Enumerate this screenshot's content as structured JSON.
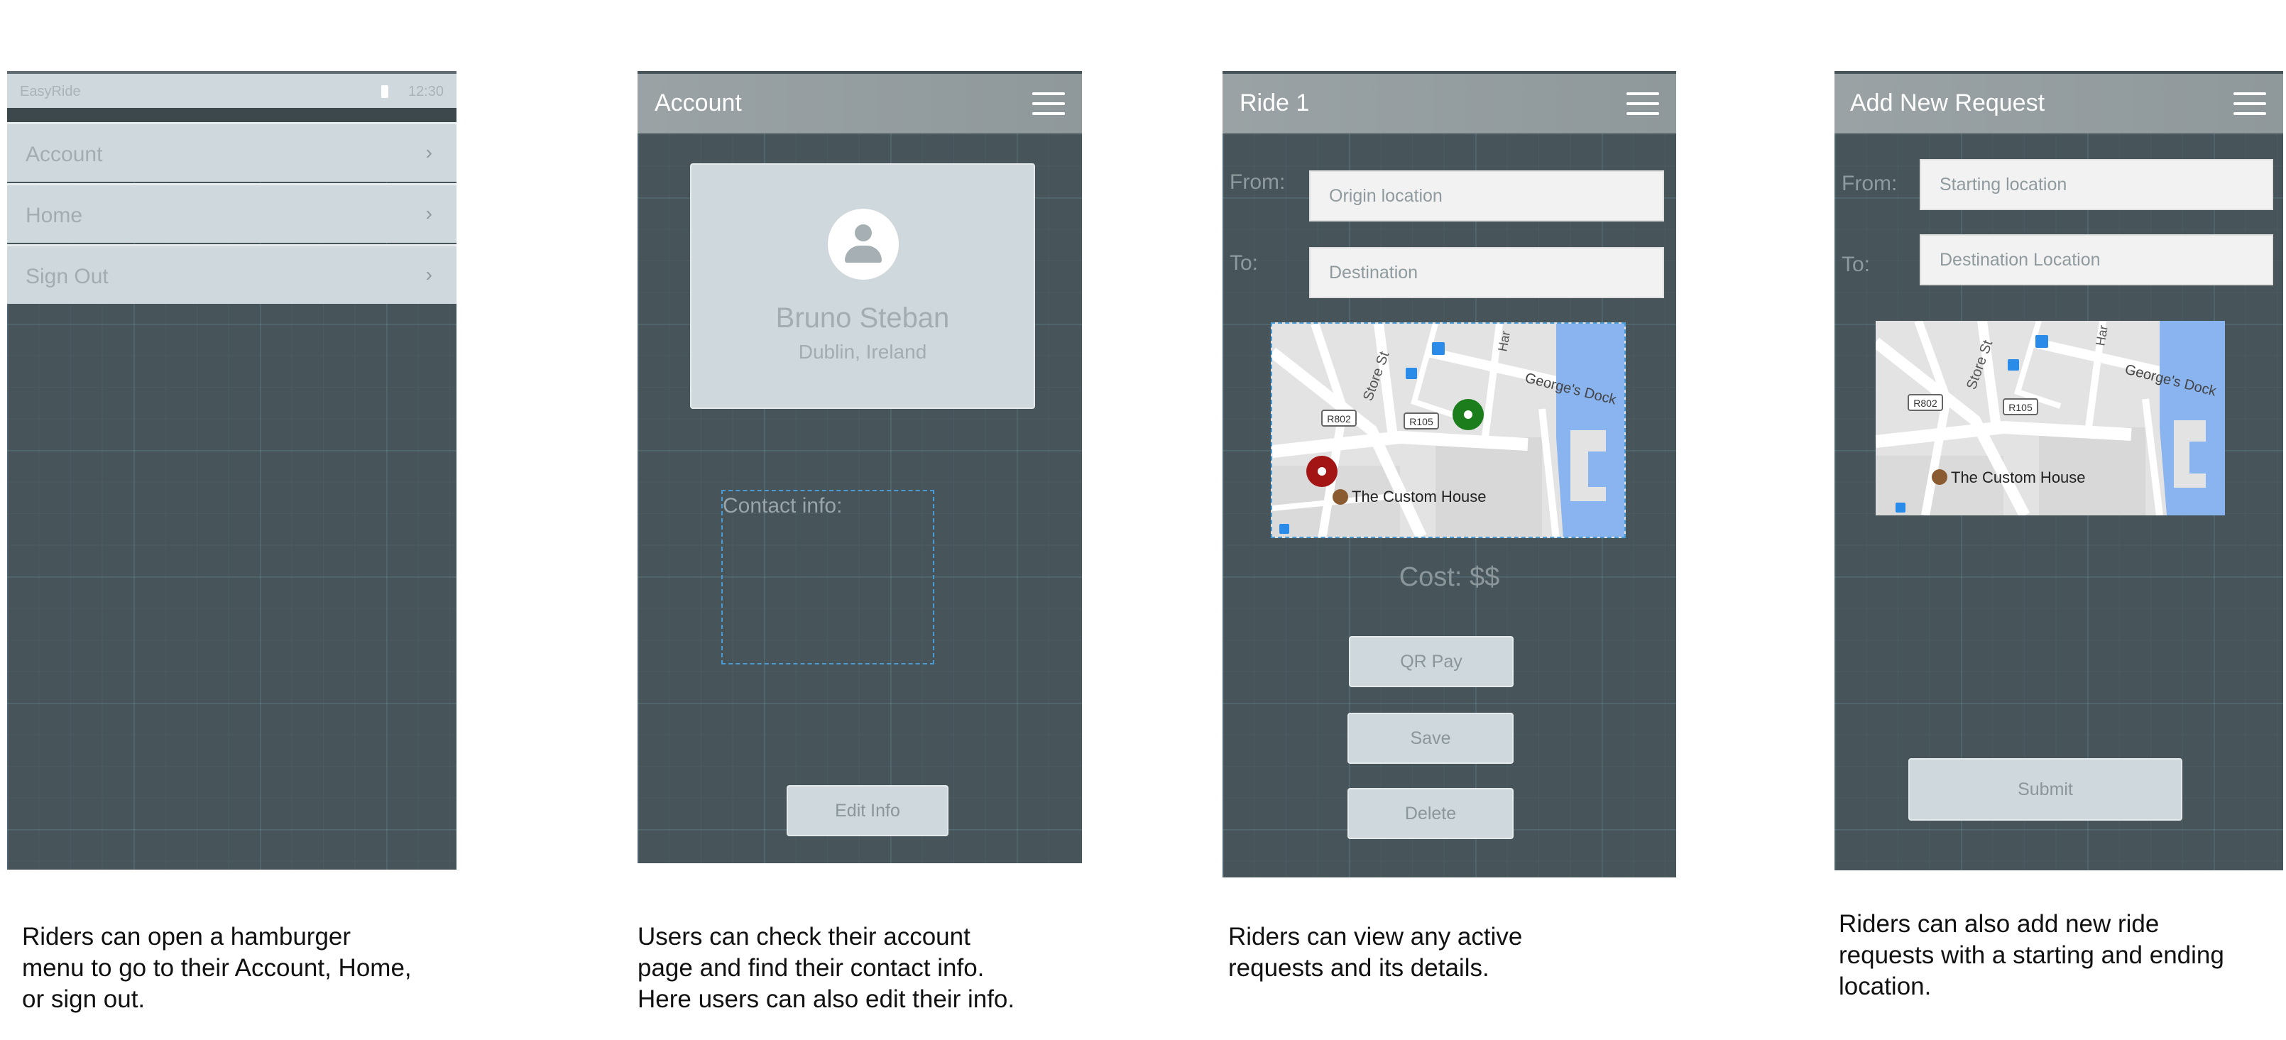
{
  "screen_menu": {
    "status_app_name": "EasyRide",
    "status_time": "12:30",
    "menu_items": [
      {
        "label": "Account",
        "chevron": "›"
      },
      {
        "label": "Home",
        "chevron": "›"
      },
      {
        "label": "Sign Out",
        "chevron": "›"
      }
    ],
    "caption": "Riders can open a hamburger\nmenu to go to their Account, Home,\nor sign out."
  },
  "screen_account": {
    "title": "Account",
    "profile_name": "Bruno Steban",
    "profile_location": "Dublin, Ireland",
    "contact_label": "Contact info:",
    "edit_button": "Edit Info",
    "caption": "Users can check their account\npage and find their contact info.\nHere users can also edit their info."
  },
  "screen_ride": {
    "title": "Ride 1",
    "from_label": "From:",
    "from_value": "Origin location",
    "to_label": "To:",
    "to_value": "Destination",
    "map_labels": {
      "street_store": "Store St",
      "dock": "George's Dock",
      "road_r802": "R802",
      "road_r105": "R105",
      "custom_house": "The Custom House",
      "hall": "Har"
    },
    "cost": "Cost: $$",
    "buttons": [
      "QR Pay",
      "Save",
      "Delete"
    ],
    "caption": "Riders can view any active\nrequests and its details."
  },
  "screen_request": {
    "title": "Add New Request",
    "from_label": "From:",
    "from_placeholder": "Starting location",
    "to_label": "To:",
    "to_placeholder": "Destination Location",
    "map_labels": {
      "street_store": "Store St",
      "dock": "George's Dock",
      "road_r802": "R802",
      "road_r105": "R105",
      "custom_house": "The Custom House",
      "hall": "Har"
    },
    "submit_button": "Submit",
    "caption": "Riders can also add new ride\nrequests with a starting and ending\nlocation."
  },
  "colors": {
    "screen_bg": "#47555a",
    "appbar": "#9aa2a5",
    "card": "#cfd8dc",
    "pickup_marker": "#1b7d1b",
    "dropoff_marker": "#a31515",
    "water": "#8ab4f0"
  },
  "icons": [
    "hamburger-menu-icon",
    "chevron-right-icon",
    "avatar-person-icon",
    "battery-icon",
    "map-marker-icon",
    "landmark-icon"
  ]
}
